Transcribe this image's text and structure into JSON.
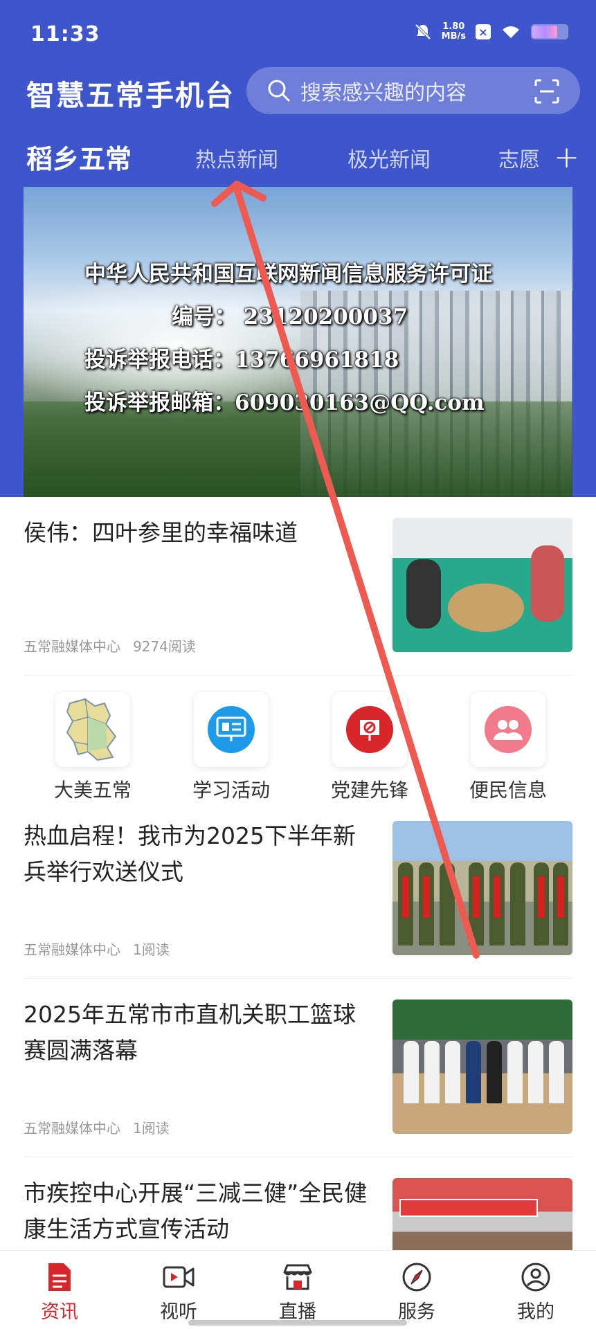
{
  "status_bar": {
    "time": "11:33",
    "net_speed_value": "1.80",
    "net_speed_unit": "MB/s"
  },
  "header": {
    "app_title": "智慧五常手机台",
    "search_placeholder": "搜索感兴趣的内容"
  },
  "tabs": [
    {
      "label": "稻乡五常",
      "active": true
    },
    {
      "label": "热点新闻",
      "active": false
    },
    {
      "label": "极光新闻",
      "active": false
    },
    {
      "label": "志愿",
      "active": false
    }
  ],
  "tab_add_label": "+",
  "banner": {
    "line1": "中华人民共和国互联网新闻信息服务许可证",
    "line2": "编号： 23120200037",
    "line3": "投诉举报电话：13766961818",
    "line4": "投诉举报邮箱：609030163@QQ.com"
  },
  "articles": [
    {
      "title": "侯伟：四叶参里的幸福味道",
      "source": "五常融媒体中心",
      "reads": "9274阅读"
    },
    {
      "title": "热血启程！我市为2025下半年新兵举行欢送仪式",
      "source": "五常融媒体中心",
      "reads": "1阅读"
    },
    {
      "title": "2025年五常市市直机关职工篮球赛圆满落幕",
      "source": "五常融媒体中心",
      "reads": "1阅读"
    },
    {
      "title": "市疾控中心开展“三减三健”全民健康生活方式宣传活动",
      "source": "",
      "reads": ""
    }
  ],
  "quick_links": [
    {
      "label": "大美五常",
      "icon": "map-icon"
    },
    {
      "label": "学习活动",
      "icon": "study-board-icon",
      "color": "#1e9be8"
    },
    {
      "label": "党建先锋",
      "icon": "party-emblem-icon",
      "color": "#d8262c"
    },
    {
      "label": "便民信息",
      "icon": "people-icon",
      "color": "#f27a8a"
    }
  ],
  "bottom_nav": [
    {
      "label": "资讯",
      "icon": "news-doc-icon",
      "active": true
    },
    {
      "label": "视听",
      "icon": "video-camera-icon",
      "active": false
    },
    {
      "label": "直播",
      "icon": "live-store-icon",
      "active": false
    },
    {
      "label": "服务",
      "icon": "compass-icon",
      "active": false
    },
    {
      "label": "我的",
      "icon": "user-circle-icon",
      "active": false
    }
  ],
  "colors": {
    "header_bg": "#3f55cc",
    "accent_red": "#d8262c",
    "annotation_arrow": "#ee5a52"
  }
}
